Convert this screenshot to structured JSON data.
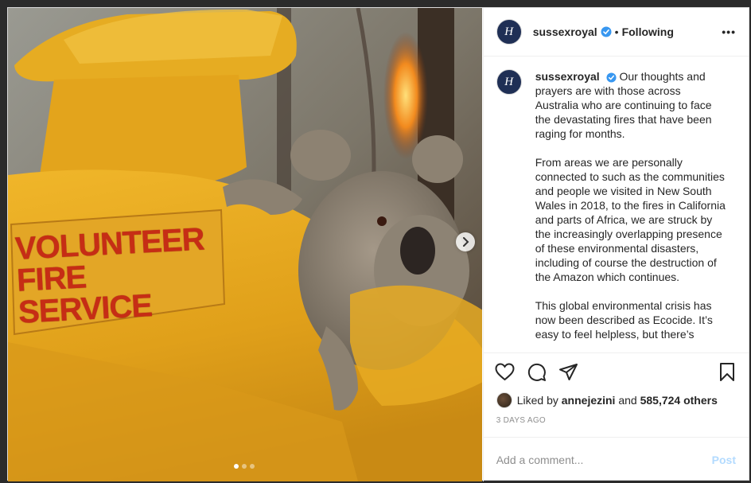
{
  "photo": {
    "patch_line1": "VOLUNTEER",
    "patch_line2": "FIRE SERVICE"
  },
  "carousel": {
    "next_icon": "chevron-right-icon",
    "dots": 3,
    "active_dot": 1
  },
  "header": {
    "username": "sussexroyal",
    "separator": "•",
    "follow_status": "Following",
    "more_label": "•••"
  },
  "caption": {
    "username": "sussexroyal",
    "paragraphs": [
      "Our thoughts and prayers are with those across Australia who are continuing to face the devastating fires that have been raging for months.",
      "From areas we are personally connected to such as the communities and people we visited in New South Wales in 2018, to the fires in California and parts of Africa, we are struck by the increasingly overlapping presence of these environmental disasters, including of course the destruction of the Amazon which continues.",
      "This global environmental crisis has now been described as Ecocide. It’s easy to feel helpless, but there’s"
    ]
  },
  "actions": {
    "like_icon": "heart-icon",
    "comment_icon": "comment-icon",
    "share_icon": "share-icon",
    "save_icon": "bookmark-icon"
  },
  "likes": {
    "prefix": "Liked by",
    "user": "annejezini",
    "and": "and",
    "count": "585,724 others"
  },
  "timestamp": "3 DAYS AGO",
  "comment_box": {
    "placeholder": "Add a comment...",
    "post_label": "Post"
  },
  "colors": {
    "verified": "#3897f0",
    "post_disabled": "#b3dbff",
    "jacket": "#e0a81c",
    "patch_text": "#c62d15"
  }
}
